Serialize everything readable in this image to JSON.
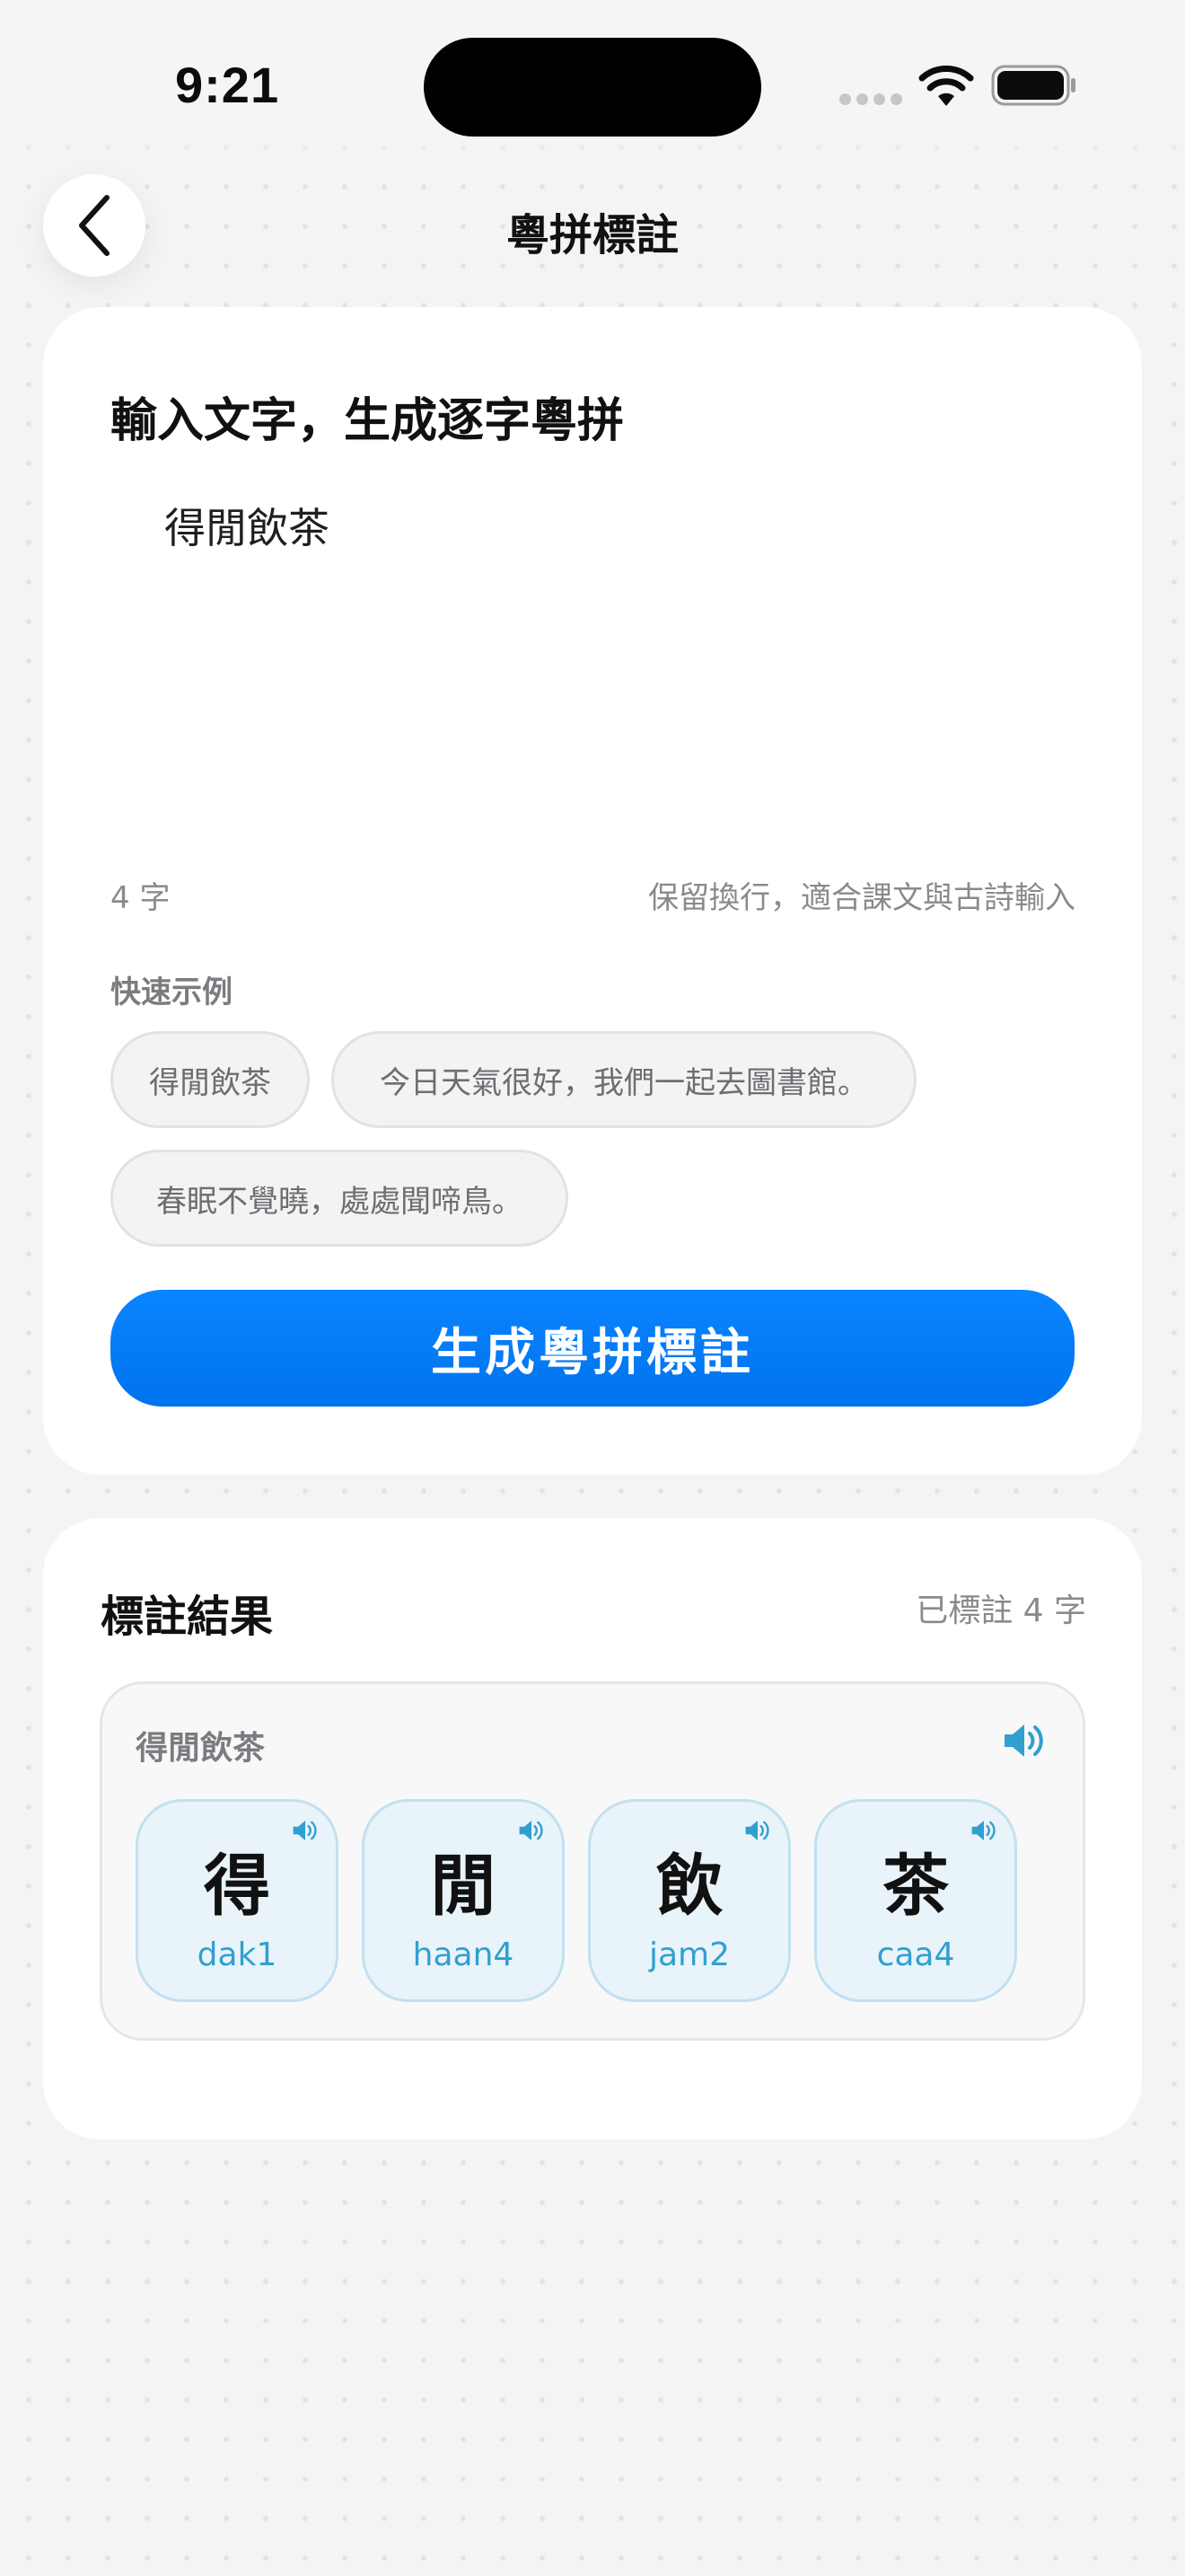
{
  "status_bar": {
    "time": "9:21"
  },
  "nav": {
    "title": "粵拼標註",
    "back_icon": "chevron-left-icon"
  },
  "input_card": {
    "heading": "輸入文字，生成逐字粵拼",
    "input_value": "得閒飲茶",
    "char_count": "4 字",
    "hint": "保留換行，適合課文與古詩輸入",
    "examples_label": "快速示例",
    "examples": [
      "得閒飲茶",
      "今日天氣很好，我們一起去圖書館。",
      "春眠不覺曉，處處聞啼鳥。"
    ],
    "generate_label": "生成粵拼標註"
  },
  "result_card": {
    "heading": "標註結果",
    "count": "已標註 4 字",
    "source_text": "得閒飲茶",
    "characters": [
      {
        "char": "得",
        "jyutping": "dak1"
      },
      {
        "char": "閒",
        "jyutping": "haan4"
      },
      {
        "char": "飲",
        "jyutping": "jam2"
      },
      {
        "char": "茶",
        "jyutping": "caa4"
      }
    ],
    "speaker_icon": "speaker-icon"
  },
  "colors": {
    "accent": "#0a84ff",
    "jyutping": "#2fa0d0",
    "tile_bg": "#e8f3fa"
  }
}
